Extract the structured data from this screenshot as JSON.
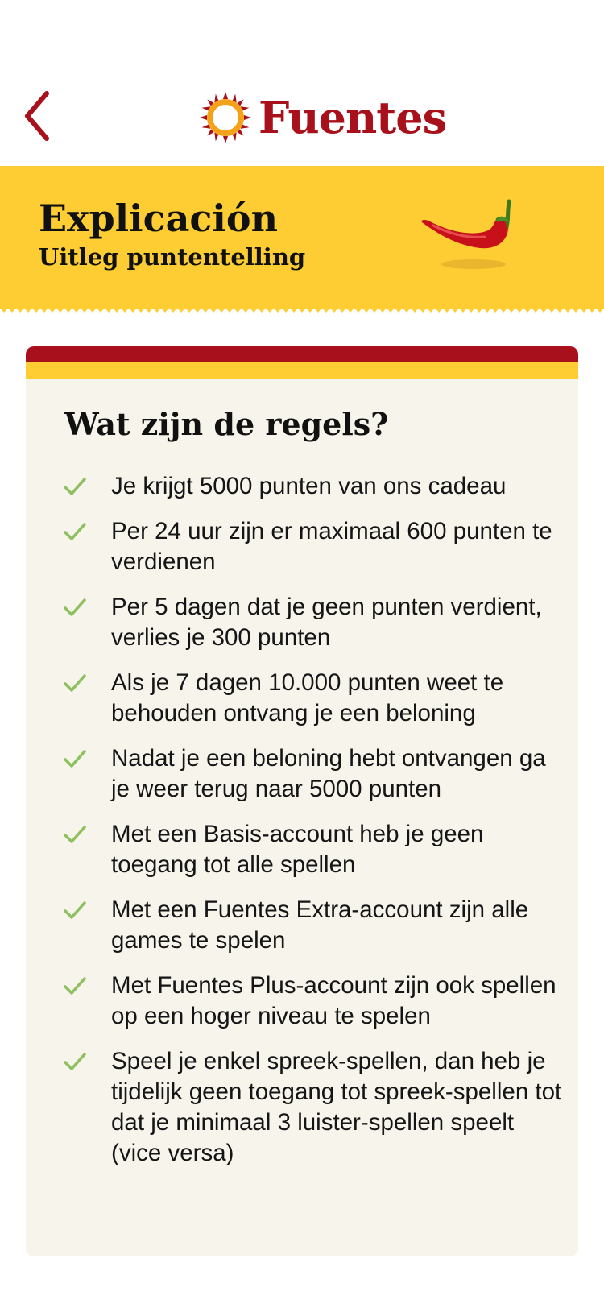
{
  "header": {
    "brand": "Fuentes",
    "back_icon": "chevron-left-icon",
    "logo_icon": "sun-icon",
    "accent_color": "#a8101c"
  },
  "banner": {
    "title": "Explicación",
    "subtitle": "Uitleg puntentelling",
    "image": "chili-pepper-icon",
    "background_color": "#fdcd33"
  },
  "card": {
    "heading": "Wat zijn de regels?",
    "check_icon": "check-icon",
    "check_color": "#8fc060",
    "rules": [
      "Je krijgt 5000 punten van ons cadeau",
      "Per 24 uur zijn er maximaal 600 punten te verdienen",
      "Per 5 dagen dat je geen punten verdient, verlies je 300 punten",
      "Als je 7 dagen 10.000 punten weet te behouden ontvang je een beloning",
      "Nadat je een beloning hebt ontvangen ga je weer terug naar 5000 punten",
      "Met een Basis-account heb je geen toegang tot alle spellen",
      "Met een Fuentes Extra-account zijn alle games te spelen",
      "Met Fuentes Plus-account zijn ook spellen op een hoger niveau te spelen",
      "Speel je enkel spreek-spellen, dan heb je tijdelijk geen toegang tot spreek-spellen tot dat je minimaal 3 luister-spellen speelt (vice versa)"
    ]
  }
}
